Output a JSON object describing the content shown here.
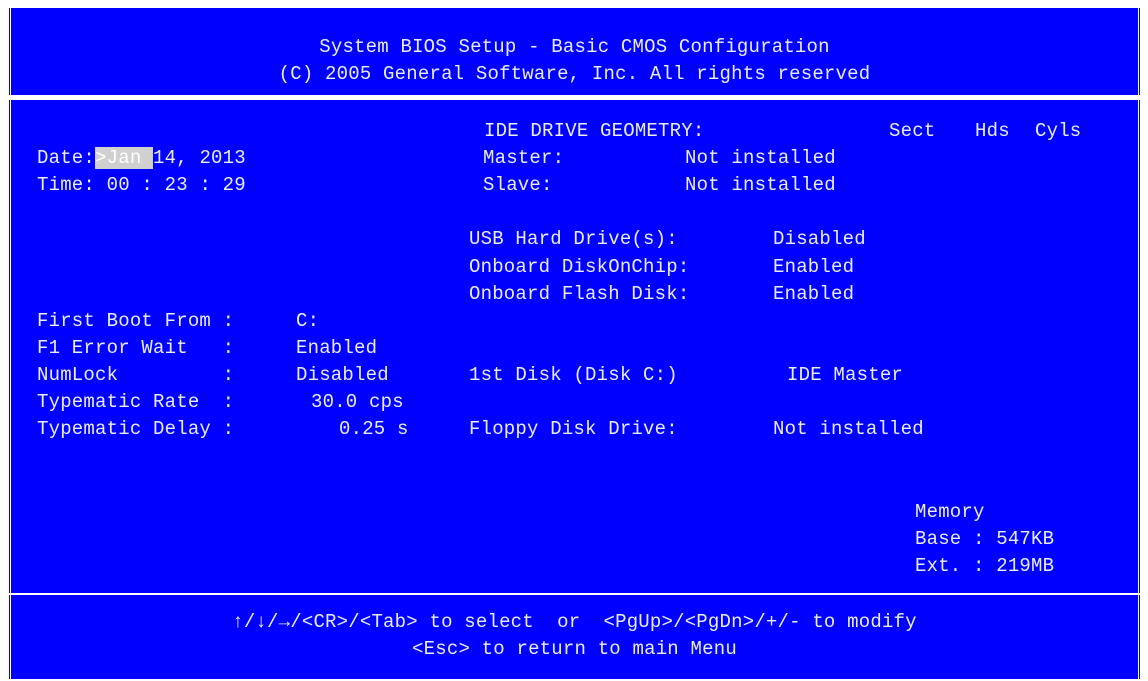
{
  "header": {
    "title": "System BIOS Setup - Basic CMOS Configuration",
    "copyright": "(C) 2005 General Software, Inc. All rights reserved"
  },
  "datetime": {
    "date_label": "Date:",
    "date_cursor": ">Jan ",
    "date_rest": "14, 2013",
    "time_label": "Time:",
    "time_value": "00 : 23 : 29"
  },
  "ide": {
    "heading": "IDE DRIVE GEOMETRY:",
    "col_sect": "Sect",
    "col_hds": "Hds",
    "col_cyls": "Cyls",
    "master_label": "Master:",
    "master_value": "Not installed",
    "slave_label": "Slave:",
    "slave_value": "Not installed"
  },
  "drives": [
    {
      "label": "USB Hard Drive(s):",
      "value": "Disabled"
    },
    {
      "label": "Onboard DiskOnChip:",
      "value": "Enabled"
    },
    {
      "label": "Onboard Flash Disk:",
      "value": "Enabled"
    }
  ],
  "options": [
    {
      "label": "First Boot From :",
      "value": "C:"
    },
    {
      "label": "F1 Error Wait   :",
      "value": "Enabled"
    },
    {
      "label": "NumLock         :",
      "value": "Disabled"
    },
    {
      "label": "Typematic Rate  :",
      "value": "30.0 cps"
    },
    {
      "label": "Typematic Delay :",
      "value": "0.25 s"
    }
  ],
  "first_disk": {
    "label": "1st Disk (Disk C:)",
    "value": "IDE Master"
  },
  "floppy": {
    "label": "Floppy Disk Drive:",
    "value": "Not installed"
  },
  "memory": {
    "title": "Memory",
    "base": "Base : 547KB",
    "ext": "Ext. : 219MB"
  },
  "footer": {
    "line1": "↑/↓/→/<CR>/<Tab> to select  or  <PgUp>/<PgDn>/+/- to modify",
    "line2": "<Esc> to return to main Menu"
  },
  "colors": {
    "background": "#0000fe",
    "text": "#ececff",
    "highlight": "#d0d0d0"
  }
}
